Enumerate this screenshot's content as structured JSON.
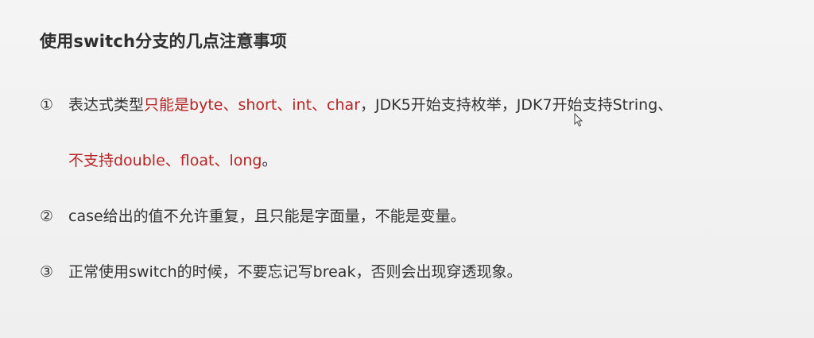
{
  "slide": {
    "title": "使用switch分支的几点注意事项",
    "item1": {
      "num": "①",
      "prefix": "表达式类型",
      "red_part": "只能是byte、short、int、char",
      "rest": "，JDK5开始支持枚举，JDK7开始支持String、",
      "continuation_red": "不支持double、float、long",
      "continuation_end": "。"
    },
    "item2": {
      "num": "②",
      "text": "case给出的值不允许重复，且只能是字面量，不能是变量。"
    },
    "item3": {
      "num": "③",
      "text": "正常使用switch的时候，不要忘记写break，否则会出现穿透现象。"
    }
  },
  "colors": {
    "background": "#f2f2f2",
    "text": "#333333",
    "highlight_red": "#b82424"
  },
  "icons": {
    "cursor": "mouse-pointer-icon"
  }
}
